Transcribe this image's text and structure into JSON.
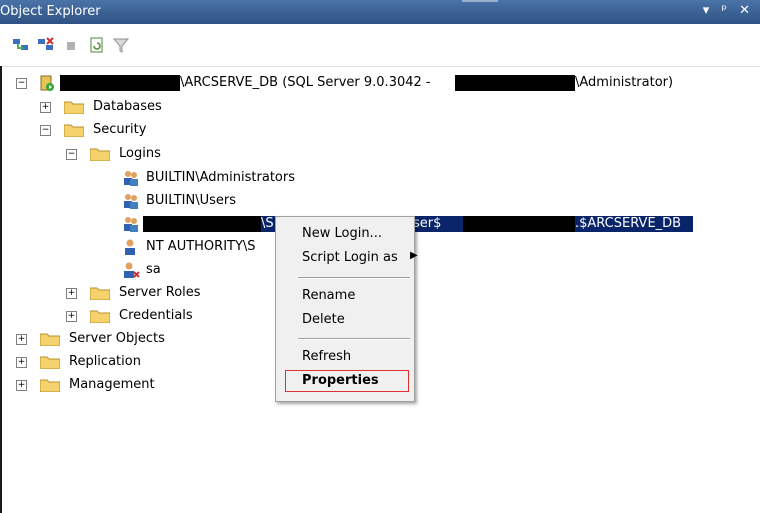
{
  "panel": {
    "title": "Object Explorer",
    "controls": "▾ ᵖ ✕"
  },
  "toolbar": {
    "buttons": [
      {
        "name": "connect-icon"
      },
      {
        "name": "disconnect-icon"
      },
      {
        "name": "stop-icon"
      },
      {
        "name": "refresh-icon"
      },
      {
        "name": "filter-icon"
      }
    ]
  },
  "tree": {
    "server": {
      "label_mid": "\\ARCSERVE_DB (SQL Server 9.0.3042 - ",
      "label_end": "\\Administrator)"
    },
    "databases": "Databases",
    "security": "Security",
    "logins": "Logins",
    "login_items": [
      "BUILTIN\\Administrators",
      "BUILTIN\\Users",
      "NT AUTHORITY\\S",
      "sa"
    ],
    "selected_login": {
      "part1": "\\S",
      "part2": "ser$",
      "part3": ".$ARCSERVE_DB"
    },
    "server_roles": "Server Roles",
    "credentials": "Credentials",
    "server_objects": "Server Objects",
    "replication": "Replication",
    "management": "Management"
  },
  "context_menu": {
    "new_login": "New Login...",
    "script_login_as": "Script Login as",
    "rename": "Rename",
    "delete": "Delete",
    "refresh": "Refresh",
    "properties": "Properties"
  },
  "colors": {
    "titlebar": "#3a5f8f",
    "selection": "#0a246a",
    "highlight_box": "#e03030",
    "folder": "#f5d26b"
  }
}
